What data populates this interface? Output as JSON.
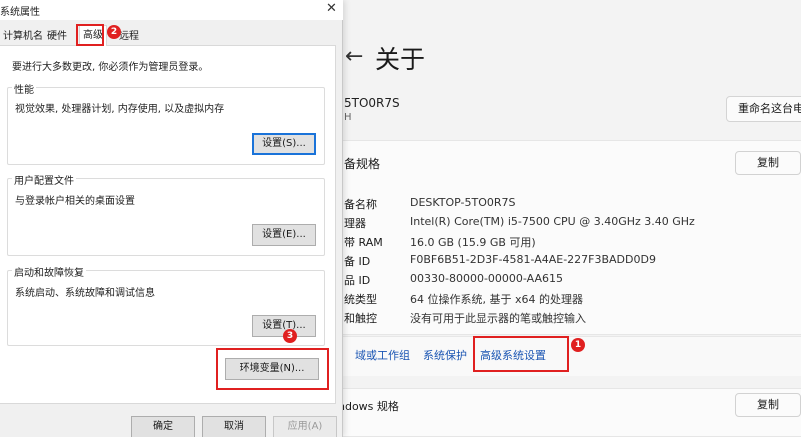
{
  "settings": {
    "back_arrow": "←",
    "page_title": "关于",
    "device_name": "5TO0R7S",
    "device_sub": "H",
    "rename_button": "重命名这台电",
    "spec_section_title": "备规格",
    "copy_button": "复制",
    "specs": [
      {
        "key": "备名称",
        "value": "DESKTOP-5TO0R7S"
      },
      {
        "key": "理器",
        "value": "Intel(R) Core(TM) i5-7500 CPU @ 3.40GHz   3.40 GHz"
      },
      {
        "key": "带 RAM",
        "value": "16.0 GB (15.9 GB 可用)"
      },
      {
        "key": "备 ID",
        "value": "F0BF6B51-2D3F-4581-A4AE-227F3BADD0D9"
      },
      {
        "key": "品 ID",
        "value": "00330-80000-00000-AA615"
      },
      {
        "key": "统类型",
        "value": "64 位操作系统, 基于 x64 的处理器"
      },
      {
        "key": "和触控",
        "value": "没有可用于此显示器的笔或触控输入"
      }
    ],
    "links": {
      "domain": "域或工作组",
      "protection": "系统保护",
      "advanced": "高级系统设置"
    },
    "windows_section_title": "ndows 规格",
    "copy_button_2": "复制"
  },
  "dialog": {
    "title": "系统属性",
    "close_icon": "✕",
    "tabs": {
      "computer_name": "计算机名",
      "hardware": "硬件",
      "advanced": "高级",
      "remote": "远程"
    },
    "admin_note": "要进行大多数更改, 你必须作为管理员登录。",
    "performance": {
      "label": "性能",
      "desc": "视觉效果, 处理器计划, 内存使用, 以及虚拟内存",
      "button": "设置(S)..."
    },
    "user_profiles": {
      "label": "用户配置文件",
      "desc": "与登录帐户相关的桌面设置",
      "button": "设置(E)..."
    },
    "startup_recovery": {
      "label": "启动和故障恢复",
      "desc": "系统启动、系统故障和调试信息",
      "button": "设置(T)..."
    },
    "env_button": "环境变量(N)...",
    "ok_button": "确定",
    "cancel_button": "取消",
    "apply_button": "应用(A)"
  },
  "annotations": {
    "badge_1": "1",
    "badge_2": "2",
    "badge_3": "3",
    "highlight_color": "#e02020"
  },
  "colors": {
    "link": "#1a55b3",
    "default_button_border": "#1a73d9"
  }
}
